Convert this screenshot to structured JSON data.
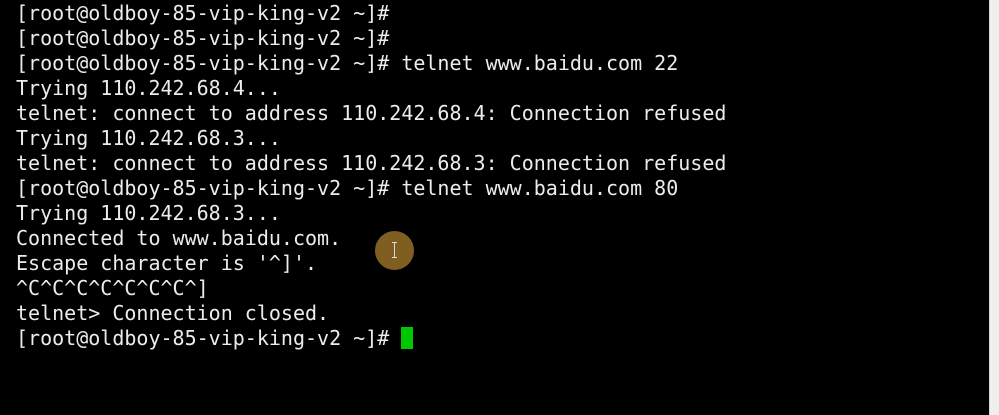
{
  "terminal": {
    "lines": [
      "[root@oldboy-85-vip-king-v2 ~]#",
      "[root@oldboy-85-vip-king-v2 ~]#",
      "[root@oldboy-85-vip-king-v2 ~]# telnet www.baidu.com 22",
      "Trying 110.242.68.4...",
      "telnet: connect to address 110.242.68.4: Connection refused",
      "Trying 110.242.68.3...",
      "telnet: connect to address 110.242.68.3: Connection refused",
      "[root@oldboy-85-vip-king-v2 ~]# telnet www.baidu.com 80",
      "Trying 110.242.68.3...",
      "Connected to www.baidu.com.",
      "Escape character is '^]'.",
      "^C^C^C^C^C^C^C^]",
      "telnet> Connection closed.",
      "[root@oldboy-85-vip-king-v2 ~]#"
    ],
    "cursor_color": "#00c800"
  }
}
